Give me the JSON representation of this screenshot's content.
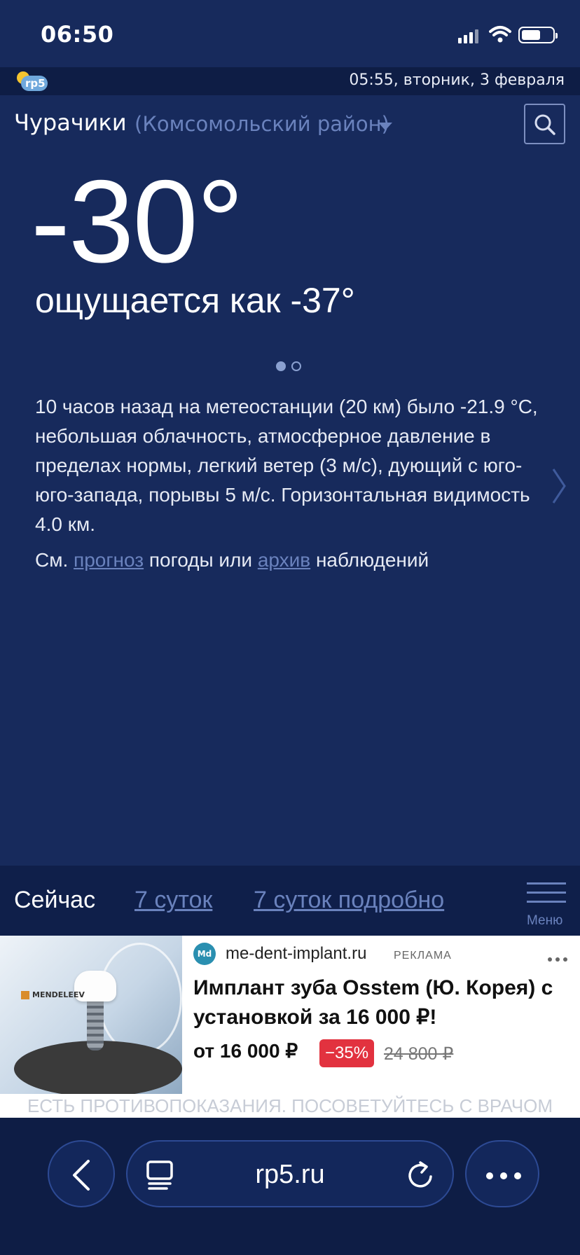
{
  "status_bar": {
    "time": "06:50",
    "icons": [
      "signal-icon",
      "wifi-icon",
      "battery-icon"
    ]
  },
  "top_strip": {
    "logo_text": "rp5",
    "datetime": "05:55, вторник, 3 февраля"
  },
  "location": {
    "city": "Чурачики",
    "district": "(Комсомольский район)"
  },
  "weather": {
    "temperature": "-30°",
    "feels_like": "ощущается как -37°",
    "description": "10 часов назад на метеостанции (20 км) было -21.9 °С, небольшая облачность, атмосферное давление в пределах нормы, легкий ветер (3 м/с), дующий с юго-юго-запада, порывы 5 м/с. Горизонтальная видимость 4.0 км.",
    "see_prefix": "См. ",
    "forecast_link": "прогноз",
    "middle_text": " погоды или ",
    "archive_link": "архив",
    "suffix_text": " наблюдений"
  },
  "nav": {
    "now": "Сейчас",
    "days7": "7 суток",
    "days7_detailed": "7 суток подробно",
    "menu": "Меню"
  },
  "ad": {
    "image_brand": "MENDELEEV",
    "icon_text": "Md",
    "domain": "me-dent-implant.ru",
    "tag": "РЕКЛАМА",
    "title": "Имплант зуба Osstem (Ю. Корея) с установкой за 16 000 ₽!",
    "price": "от 16 000 ₽",
    "discount": "−35%",
    "old_price": "24 800 ₽",
    "disclaimer": "ЕСТЬ ПРОТИВОПОКАЗАНИЯ. ПОСОВЕТУЙТЕСЬ С ВРАЧОМ"
  },
  "browser": {
    "url": "rp5.ru"
  },
  "colors": {
    "background": "#172a5c",
    "link": "#6a82bd",
    "discount_badge": "#e2323f"
  }
}
